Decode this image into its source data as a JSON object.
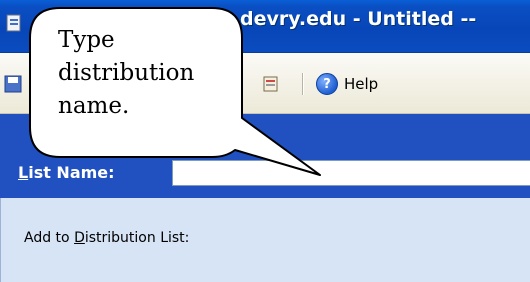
{
  "window": {
    "title": "devry.edu - Untitled --"
  },
  "toolbar": {
    "help_label": "Help"
  },
  "list_name": {
    "label_first": "L",
    "label_rest": "ist Name:",
    "value": ""
  },
  "distribution": {
    "label_before": "Add to ",
    "label_accel": "D",
    "label_after": "istribution List:"
  },
  "callout": {
    "text": "Type distribution name."
  }
}
